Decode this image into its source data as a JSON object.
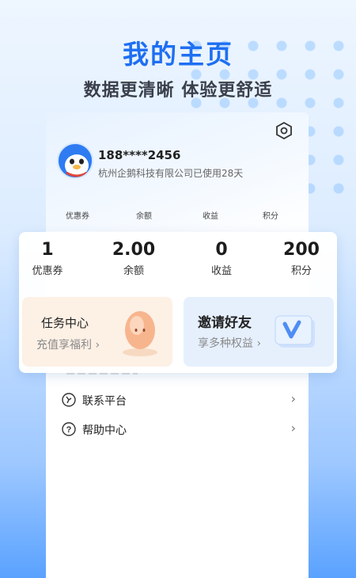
{
  "headline": "我的主页",
  "subline": "数据更清晰 体验更舒适",
  "profile": {
    "phone": "188****2456",
    "company_usage": "杭州企鹅科技有限公司已使用28天"
  },
  "mini_stats": [
    "优惠券",
    "余额",
    "收益",
    "积分"
  ],
  "stats": [
    {
      "value": "1",
      "label": "优惠券"
    },
    {
      "value": "2.00",
      "label": "余额"
    },
    {
      "value": "0",
      "label": "收益"
    },
    {
      "value": "200",
      "label": "积分"
    }
  ],
  "promos": {
    "task": {
      "title": "任务中心",
      "sub": "充值享福利 ›"
    },
    "invite": {
      "title": "邀请好友",
      "sub": "享多种权益 ›"
    }
  },
  "menu": [
    {
      "label": "联系平台",
      "icon": "contact-icon",
      "chevron": "›"
    },
    {
      "label": "帮助中心",
      "icon": "help-icon",
      "chevron": "›"
    }
  ],
  "colors": {
    "accent": "#1e6ff2",
    "task_bg": "#fdf0e5",
    "invite_bg": "#e6f0fd"
  }
}
